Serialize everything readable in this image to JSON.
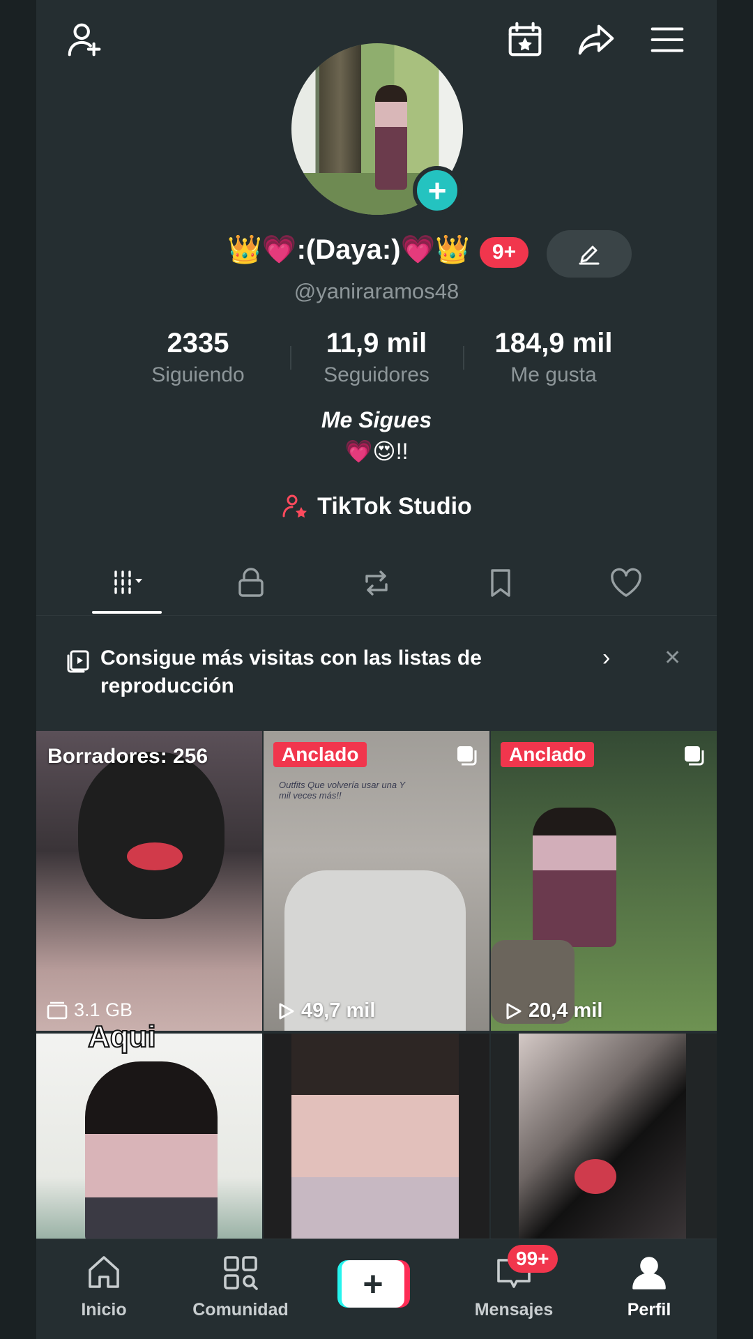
{
  "header": {
    "icons": [
      "add-friend-icon",
      "calendar-star-icon",
      "share-icon",
      "menu-icon"
    ]
  },
  "profile": {
    "display_name": "👑💗:(Daya:)💗👑",
    "notification_badge": "9+",
    "username": "@yaniraramos48",
    "stats": [
      {
        "value": "2335",
        "label": "Siguiendo"
      },
      {
        "value": "11,9 mil",
        "label": "Seguidores"
      },
      {
        "value": "184,9 mil",
        "label": "Me gusta"
      }
    ],
    "bio_title": "Me Sigues",
    "bio_line": "💗😍!!",
    "studio_label": "TikTok Studio"
  },
  "tabs": [
    "videos-grid",
    "private",
    "reposts",
    "favorites",
    "liked"
  ],
  "promo": {
    "text": "Consigue más visitas con las listas de reproducción"
  },
  "grid": {
    "drafts_label": "Borradores: 256",
    "drafts_size": "3.1 GB",
    "pinned_label": "Anclado",
    "items": [
      {
        "type": "drafts"
      },
      {
        "pinned": true,
        "views": "49,7 mil",
        "caption": "Outfits Que volvería usar una Y mil veces más!!"
      },
      {
        "pinned": true,
        "views": "20,4 mil"
      },
      {
        "overlay": "Aqui"
      },
      {},
      {}
    ]
  },
  "bottom_nav": {
    "items": [
      {
        "label": "Inicio",
        "icon": "home-icon"
      },
      {
        "label": "Comunidad",
        "icon": "community-icon"
      },
      {
        "label": "",
        "icon": "plus-icon"
      },
      {
        "label": "Mensajes",
        "icon": "inbox-icon",
        "badge": "99+"
      },
      {
        "label": "Perfil",
        "icon": "profile-icon"
      }
    ]
  },
  "colors": {
    "background": "#252e31",
    "accent_red": "#f1364d",
    "teal": "#24c3c0",
    "muted_text": "#8d9699"
  }
}
